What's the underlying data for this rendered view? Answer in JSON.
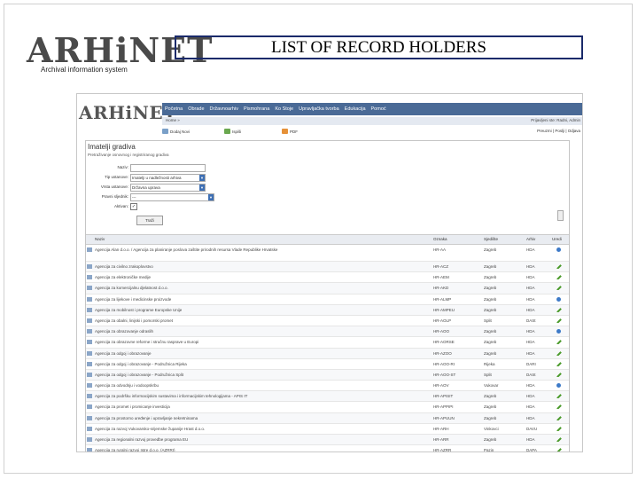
{
  "slide": {
    "logo_text": "ARHiNET",
    "logo_subtitle": "Archival information system",
    "title": "LIST OF RECORD HOLDERS"
  },
  "app": {
    "logo_text": "ARHiNET",
    "nav": [
      "Početna",
      "Obrade",
      "Državnoarhiv",
      "Pismohrana",
      "Ko Stoje",
      "Upravljačka tvorba",
      "Edukacija",
      "Pomoć"
    ],
    "breadcrumb": "Home »",
    "user_info": "Prijavljeni ste: Radni, Admin",
    "toolbar": {
      "new": "Dodaj Novi",
      "print": "Ispiši",
      "export": "PDF",
      "right": "Preuzmi | Poslji | Odjava"
    }
  },
  "panel": {
    "title": "Imatelji gradiva",
    "subtitle": "Pretraživanje osnovnog i registriranog gradiva",
    "form": {
      "name_label": "Naziv:",
      "name_value": "",
      "type_label": "Tip ustanove:",
      "type_value": "Imatelji u nadležnosti arhiva",
      "status_label": "Vrsta ustanove:",
      "status_value": "Državna uprava",
      "archive_label": "Pravni sljednik:",
      "archive_value": "---",
      "active_label": "Aktivan:",
      "active_value": "✓",
      "search_button": "Traži"
    }
  },
  "grid": {
    "headers": {
      "name": "Naziv",
      "oz": "Oznaka",
      "sj": "Sjedište",
      "ar": "Arhiv",
      "ed": "Uredi"
    },
    "rows": [
      {
        "name": "Agencija Alan d.o.o. / Agencija za planiranje poslova zaštite prirodnih resursa Vlade Republike Hrvatske",
        "oz": "HR-AA",
        "sj": "Zagreb",
        "ar": "HDA",
        "tall": true,
        "icon": "globe"
      },
      {
        "name": "Agencija za civilno zrakoplovstvo",
        "oz": "HR-ACZ",
        "sj": "Zagreb",
        "ar": "HDA",
        "icon": "pencil"
      },
      {
        "name": "Agencija za elektroničke medije",
        "oz": "HR-AEM",
        "sj": "Zagreb",
        "ar": "HDA",
        "icon": "pencil"
      },
      {
        "name": "Agencija za komercijalnu djelatnost d.o.o.",
        "oz": "HR-AKD",
        "sj": "Zagreb",
        "ar": "HDA",
        "icon": "pencil"
      },
      {
        "name": "Agencija za lijekove i medicinske proizvode",
        "oz": "HR-ALMP",
        "sj": "Zagreb",
        "ar": "HDA",
        "icon": "globe"
      },
      {
        "name": "Agencija za mobilnost i programe Europske Unije",
        "oz": "HR-AMPEU",
        "sj": "Zagreb",
        "ar": "HDA",
        "icon": "pencil"
      },
      {
        "name": "Agencija za obalni, linijski i pomorski promet",
        "oz": "HR-AOLP",
        "sj": "Split",
        "ar": "DASt",
        "icon": "pencil"
      },
      {
        "name": "Agencija za obrazovanje odraslih",
        "oz": "HR-AOO",
        "sj": "Zagreb",
        "ar": "HDA",
        "icon": "globe"
      },
      {
        "name": "Agencija za obrazovne reforme i stručnu rasprave u Europi",
        "oz": "HR-AORSE",
        "sj": "Zagreb",
        "ar": "HDA",
        "icon": "pencil"
      },
      {
        "name": "Agencija za odgoj i obrazovanje",
        "oz": "HR-AZOO",
        "sj": "Zagreb",
        "ar": "HDA",
        "icon": "pencil"
      },
      {
        "name": "Agencija za odgoj i obrazovanje - Podružnica Rijeka",
        "oz": "HR-AOO-RI",
        "sj": "Rijeka",
        "ar": "DARI",
        "icon": "pencil"
      },
      {
        "name": "Agencija za odgoj i obrazovanje - Podružnica Split",
        "oz": "HR-AOO-ST",
        "sj": "Split",
        "ar": "DASt",
        "icon": "pencil"
      },
      {
        "name": "Agencija za odvodnju i vodoopskrbu",
        "oz": "HR-AOV",
        "sj": "Vukovar",
        "ar": "HDA",
        "icon": "globe"
      },
      {
        "name": "Agencija za podršku informacijskim sustavima i informacijskim tehnologijama - APIS IT",
        "oz": "HR-APISIT",
        "sj": "Zagreb",
        "ar": "HDA",
        "icon": "pencil"
      },
      {
        "name": "Agencija za promet i promicanje investicija",
        "oz": "HR-APPIPI",
        "sj": "Zagreb",
        "ar": "HDA",
        "icon": "pencil"
      },
      {
        "name": "Agencija za prostorno uređenje i upravljanje nekretninama",
        "oz": "HR-APUUN",
        "sj": "Zagreb",
        "ar": "HDA",
        "icon": "pencil"
      },
      {
        "name": "Agencija za razvoj Vukovarsko-srijemske županije Hrast d.o.o.",
        "oz": "HR-ARH",
        "sj": "Vinkovci",
        "ar": "DAVU",
        "icon": "pencil"
      },
      {
        "name": "Agencija za regionalni razvoj provedbe programa EU",
        "oz": "HR-ARR",
        "sj": "Zagreb",
        "ar": "HDA",
        "icon": "pencil"
      },
      {
        "name": "Agencija za ruralni razvoj Istre d.o.o. (AZRRI)",
        "oz": "HR-AZRR",
        "sj": "Pazin",
        "ar": "DAPA",
        "icon": "pencil"
      },
      {
        "name": "Agencija za strukovno obrazovanje",
        "oz": "HR-ASO",
        "sj": "Zagreb",
        "ar": "HDA",
        "icon": "pencil"
      }
    ]
  }
}
